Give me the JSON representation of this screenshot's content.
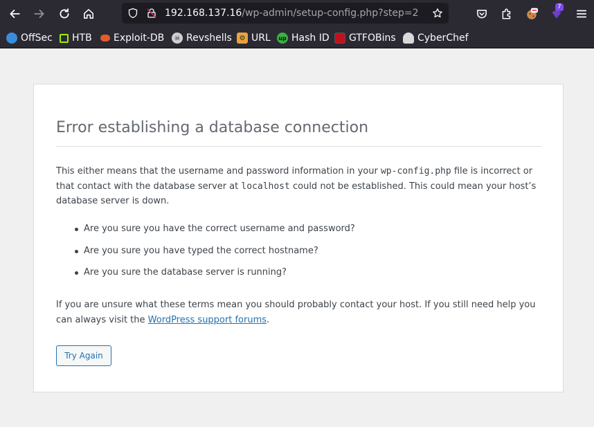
{
  "browser": {
    "url_host": "192.168.137.16",
    "url_path": "/wp-admin/setup-config.php?step=2",
    "extension_badge": "7",
    "bookmarks": [
      {
        "label": "OffSec",
        "icon": "offsec-icon",
        "color": "#3a8dde"
      },
      {
        "label": "HTB",
        "icon": "htb-icon",
        "color": "#9fef00"
      },
      {
        "label": "Exploit-DB",
        "icon": "exploit-db-icon",
        "color": "#e45b2a"
      },
      {
        "label": "Revshells",
        "icon": "skull-icon",
        "color": "#d0d0d0"
      },
      {
        "label": "URL",
        "icon": "url-icon",
        "color": "#e8a33d"
      },
      {
        "label": "Hash ID",
        "icon": "hashid-icon",
        "color": "#3cb043"
      },
      {
        "label": "GTFOBins",
        "icon": "gtfobins-icon",
        "color": "#c0121c"
      },
      {
        "label": "CyberChef",
        "icon": "cyberchef-icon",
        "color": "#d9d9d9"
      }
    ]
  },
  "page": {
    "title": "Error establishing a database connection",
    "intro_1": "This either means that the username and password information in your ",
    "intro_code_1": "wp-config.php",
    "intro_2": " file is incorrect or that contact with the database server at ",
    "intro_code_2": "localhost",
    "intro_3": " could not be established. This could mean your host’s database server is down.",
    "questions": [
      "Are you sure you have the correct username and password?",
      "Are you sure you have typed the correct hostname?",
      "Are you sure the database server is running?"
    ],
    "help_1": "If you are unsure what these terms mean you should probably contact your host. If you still need help you can always visit the ",
    "help_link": "WordPress support forums",
    "help_2": ".",
    "try_again": "Try Again"
  },
  "colors": {
    "toolbar": "#2b2a33",
    "page_bg": "#f0f0f1",
    "link": "#2271b1",
    "title": "#646970",
    "text": "#3c434a"
  }
}
